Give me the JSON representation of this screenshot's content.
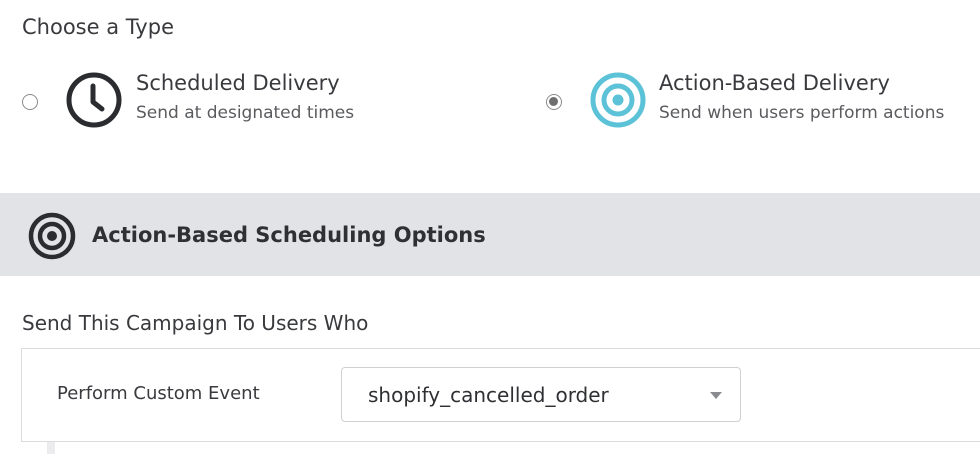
{
  "choose_type": {
    "title": "Choose a Type",
    "options": [
      {
        "title": "Scheduled Delivery",
        "description": "Send at designated times",
        "icon": "clock-icon",
        "selected": false
      },
      {
        "title": "Action-Based Delivery",
        "description": "Send when users perform actions",
        "icon": "target-icon",
        "selected": true,
        "icon_color": "#5cc2d7"
      }
    ]
  },
  "scheduling_section": {
    "title": "Action-Based Scheduling Options",
    "icon": "target-icon",
    "background_color": "#e2e3e7"
  },
  "send_to": {
    "title": "Send This Campaign To Users Who",
    "trigger_label": "Perform Custom Event",
    "trigger_value": "shopify_cancelled_order"
  }
}
